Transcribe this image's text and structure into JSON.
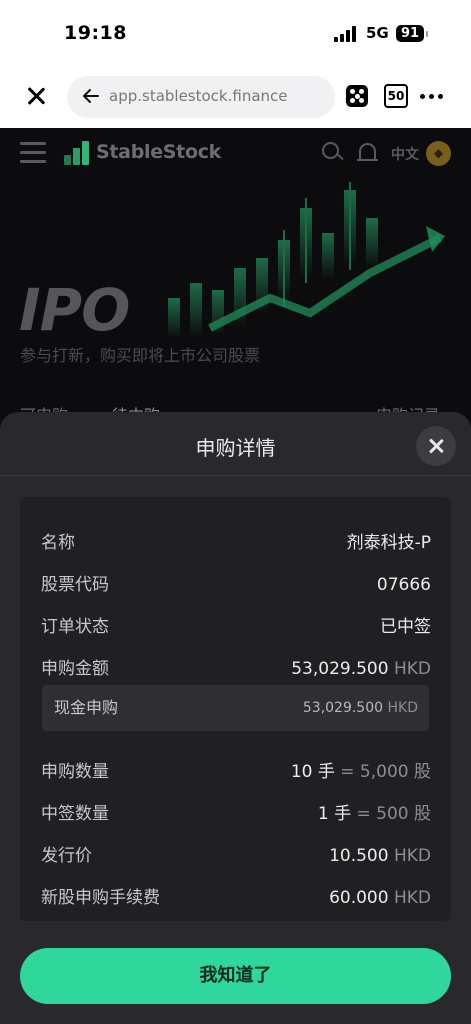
{
  "status_bar": {
    "time": "19:18",
    "network": "5G",
    "battery": "91"
  },
  "browser": {
    "url": "app.stablestock.finance",
    "tabs_count": "50"
  },
  "site": {
    "brand": "StableStock",
    "lang": "中文",
    "hero_title": "IPO",
    "hero_subtitle": "参与打新，购买即将上市公司股票",
    "tabs": [
      "可申购",
      "待中购"
    ],
    "record_link": "申购记录"
  },
  "sheet": {
    "title": "申购详情",
    "rows": [
      {
        "label": "名称",
        "value": "剂泰科技-P"
      },
      {
        "label": "股票代码",
        "value": "07666"
      },
      {
        "label": "订单状态",
        "value": "已中签"
      },
      {
        "label": "申购金额",
        "amount": "53,029.500",
        "unit": "HKD"
      },
      {
        "label": "现金申购",
        "amount": "53,029.500",
        "unit": "HKD"
      },
      {
        "label": "申购数量",
        "lots": "10 手",
        "eq": "=",
        "shares": "5,000 股"
      },
      {
        "label": "中签数量",
        "lots": "1 手",
        "eq": "=",
        "shares": "500 股"
      },
      {
        "label": "发行价",
        "amount": "10.500",
        "unit": "HKD"
      },
      {
        "label": "新股申购手续费",
        "amount": "60.000",
        "unit": "HKD"
      }
    ],
    "button_label": "我知道了"
  },
  "colors": {
    "accent": "#2fd79d",
    "sheet_bg": "#29292d",
    "card_bg": "#202023",
    "page_bg": "#0c0c0e"
  }
}
